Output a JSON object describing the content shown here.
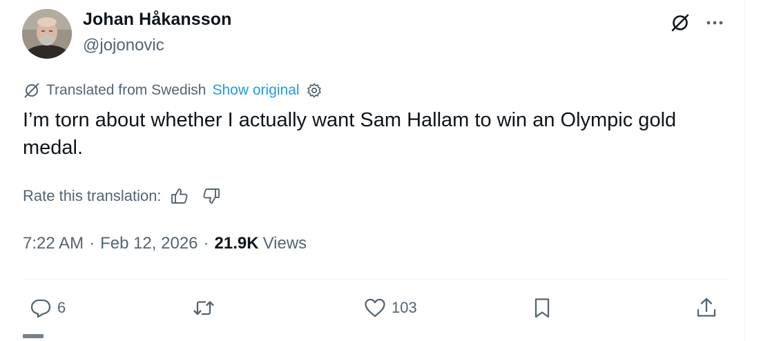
{
  "author": {
    "name": "Johan Håkansson",
    "handle": "@jojonovic"
  },
  "header_icons": {
    "grok": "grok-icon",
    "more": "more-dots-icon"
  },
  "translation": {
    "label": "Translated from Swedish",
    "show_original": "Show original",
    "settings_icon": "gear-icon",
    "rate_label": "Rate this translation:"
  },
  "tweet": {
    "text": "I’m torn about whether I actually want Sam Hallam to win an Olympic gold medal."
  },
  "meta": {
    "time": "7:22 AM",
    "separator": "·",
    "date": "Feb 12, 2026",
    "views_count": "21.9K",
    "views_label": "Views"
  },
  "actions": {
    "replies": "6",
    "reposts": "",
    "likes": "103"
  },
  "colors": {
    "text": "#0f1419",
    "muted": "#536471",
    "accent": "#1d9bf0",
    "divider": "#eff3f4"
  }
}
